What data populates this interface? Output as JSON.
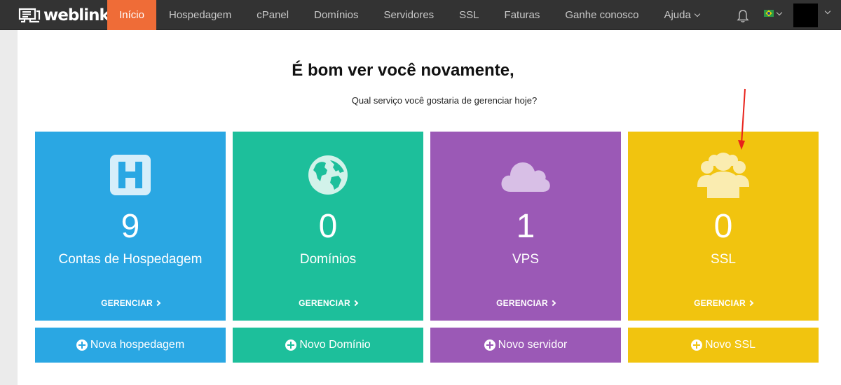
{
  "brand": {
    "name": "weblink"
  },
  "nav": {
    "items": [
      {
        "label": "Início",
        "active": true
      },
      {
        "label": "Hospedagem"
      },
      {
        "label": "cPanel"
      },
      {
        "label": "Domínios"
      },
      {
        "label": "Servidores"
      },
      {
        "label": "SSL"
      },
      {
        "label": "Faturas"
      },
      {
        "label": "Ganhe conosco"
      },
      {
        "label": "Ajuda",
        "dropdown": true
      }
    ]
  },
  "header_icons": {
    "notifications": "bell-icon",
    "language": "brazil-flag-icon"
  },
  "welcome": {
    "title": "É bom ver você novamente,",
    "subtitle": "Qual serviço você gostaria de gerenciar hoje?"
  },
  "tiles": [
    {
      "icon": "hospedagem-h-icon",
      "count": "9",
      "label": "Contas de Hospedagem",
      "manage": "GERENCIAR",
      "new_label": "Nova hospedagem",
      "color": "#2aa7e3"
    },
    {
      "icon": "globe-icon",
      "count": "0",
      "label": "Domínios",
      "manage": "GERENCIAR",
      "new_label": "Novo Domínio",
      "color": "#1dbf9b"
    },
    {
      "icon": "cloud-icon",
      "count": "1",
      "label": "VPS",
      "manage": "GERENCIAR",
      "new_label": "Novo servidor",
      "color": "#9b59b6"
    },
    {
      "icon": "users-icon",
      "count": "0",
      "label": "SSL",
      "manage": "GERENCIAR",
      "new_label": "Novo SSL",
      "color": "#f1c40f"
    }
  ],
  "colors": {
    "navbar": "#333333",
    "active_tab": "#ef6c37",
    "annotation_arrow": "#e8221b"
  }
}
